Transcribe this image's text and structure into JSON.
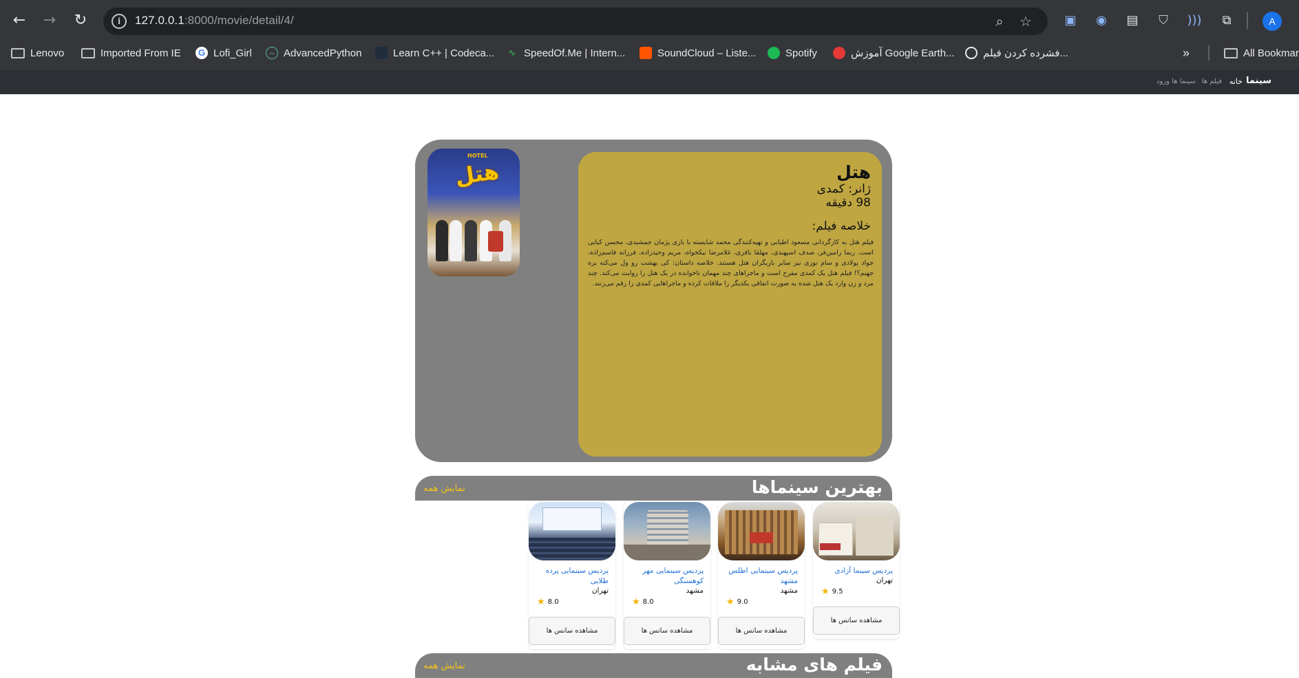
{
  "browser": {
    "url_host": "127.0.0.1",
    "url_rest": ":8000/movie/detail/4/",
    "avatar_letter": "A",
    "bookmarks": [
      {
        "label": "Lenovo",
        "icon": "folder-icon"
      },
      {
        "label": "Imported From IE",
        "icon": "folder-icon"
      },
      {
        "label": "Lofi_Girl",
        "icon": "google-icon"
      },
      {
        "label": "AdvancedPython",
        "icon": "python-icon"
      },
      {
        "label": "Learn C++ | Codeca...",
        "icon": "codecademy-icon"
      },
      {
        "label": "SpeedOf.Me | Intern...",
        "icon": "speedometer-icon"
      },
      {
        "label": "SoundCloud – Liste...",
        "icon": "soundcloud-icon"
      },
      {
        "label": "Spotify",
        "icon": "spotify-icon"
      },
      {
        "label": "آموزش Google Earth...",
        "icon": "google-earth-icon"
      },
      {
        "label": "فشرده کردن فیلم...",
        "icon": "globe-icon"
      }
    ],
    "all_bookmarks": "All Bookmarks"
  },
  "site_nav": {
    "brand": "سینما",
    "home": "خانه",
    "movies": "فیلم ها",
    "cinemas": "سینما ها",
    "login": "ورود"
  },
  "movie": {
    "title": "هتل",
    "genre": "ژانر: کمدی",
    "duration": "98 دقیقه",
    "synopsis_heading": "خلاصه فیلم:",
    "synopsis": "فیلم هتل به کارگردانی مسعود اطیابی و تهیه‌کنندگی محمد شایسته با بازی پژمان جمشیدی، محسن کیایی است. ریما رامین‌فر، صدف اسپهبدی، مهلقا باقری، غلامرضا نیکخواه، مریم وحیدزاده، فرزانه قاسم‌زاده، جواد پولادی و سام نوری نیز سایر بازیگران هتل هستند. خلاصه داستان: کی بهشت رو ول می‌کنه بره جهنم؟! فیلم هتل یک کمدی مفرح است و ماجراهای چند مهمان ناخوانده در یک هتل را روایت می‌کند. چند مرد و زن وارد یک هتل شده به صورت اتفاقی یکدیگر را ملاقات کرده و ماجراهایی کمدی را رقم می‌زنند.",
    "poster_title": "هتل",
    "poster_hotel": "HOTEL"
  },
  "best_cinemas": {
    "title": "بهترین سینماها",
    "show_all": "نمایش همه",
    "cinemas": [
      {
        "name": "پردیس سینما آزادی",
        "city": "تهران",
        "rating": "9.5",
        "button": "مشاهده سانس ها"
      },
      {
        "name": "پردیس سینمایی اطلس مشهد",
        "city": "مشهد",
        "rating": "9.0",
        "button": "مشاهده سانس ها"
      },
      {
        "name": "پردیس سینمایی مهر کوهسنگی",
        "city": "مشهد",
        "rating": "8.0",
        "button": "مشاهده سانس ها"
      },
      {
        "name": "پردیس سینمایی پرده طلایی",
        "city": "تهران",
        "rating": "8.0",
        "button": "مشاهده سانس ها"
      }
    ]
  },
  "similar_movies": {
    "title": "فیلم های مشابه",
    "show_all": "نمایش همه"
  },
  "colors": {
    "chrome_bg": "#35363a",
    "site_nav_bg": "#2c2f33",
    "card_gray": "#808080",
    "info_gold": "#bfa641",
    "accent_yellow": "#f5c518",
    "link_blue": "#1f6fd6"
  }
}
